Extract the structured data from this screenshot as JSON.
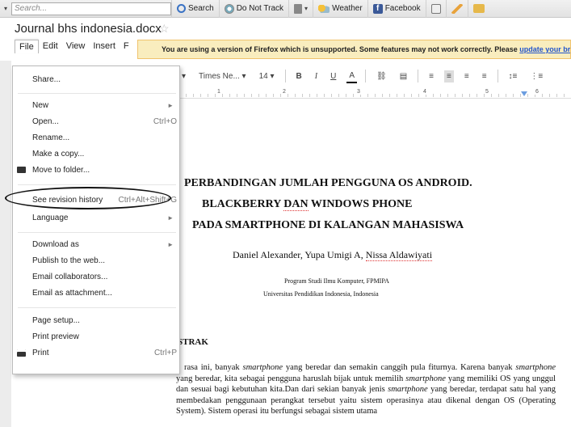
{
  "browser_toolbar": {
    "search_placeholder": "Search...",
    "buttons": [
      {
        "label": "Search",
        "icon": "search-icon"
      },
      {
        "label": "Do Not Track",
        "icon": "do-not-track-icon"
      },
      {
        "label": "",
        "icon": "trash-icon"
      },
      {
        "label": "Weather",
        "icon": "weather-icon"
      },
      {
        "label": "Facebook",
        "icon": "facebook-icon"
      }
    ],
    "facebook_letter": "f"
  },
  "doc_title": "Journal bhs indonesia.docx",
  "star": "☆",
  "menubar": [
    "File",
    "Edit",
    "View",
    "Insert",
    "F"
  ],
  "warning": {
    "text": "You are using a version of Firefox which is unsupported. Some features may not work correctly. Please ",
    "link": "update your browser"
  },
  "format_toolbar": {
    "font": "Times Ne...",
    "size": "14",
    "bold": "B",
    "italic": "I",
    "underline": "U",
    "text_color": "A"
  },
  "ruler": [
    "1",
    "2",
    "3",
    "4",
    "5",
    "6"
  ],
  "file_menu": {
    "share": "Share...",
    "new": "New",
    "open": "Open...",
    "open_shortcut": "Ctrl+O",
    "rename": "Rename...",
    "copy": "Make a copy...",
    "move": "Move to folder...",
    "revision": "See revision history",
    "revision_shortcut": "Ctrl+Alt+Shift+G",
    "language": "Language",
    "download": "Download as",
    "publish": "Publish to the web...",
    "email_collab": "Email collaborators...",
    "email_attach": "Email as attachment...",
    "page_setup": "Page setup...",
    "print_preview": "Print preview",
    "print": "Print",
    "print_shortcut": "Ctrl+P"
  },
  "document": {
    "title1": "PERBANDINGAN JUMLAH PENGGUNA OS ANDROID.",
    "title2a": "BLACKBERRY ",
    "title2b": "DAN",
    "title2c": " WINDOWS PHONE",
    "title3": "PADA SMARTPHONE DI KALANGAN MAHASISWA",
    "authors_a": "Daniel Alexander, Yupa Umigi A, ",
    "authors_b": "Nissa Aldawiyati",
    "affil1": "Program Studi Ilmu Komputer, FPMIPA",
    "affil2": "Universitas Pendidikan Indonesia, Indonesia",
    "abstract_heading": "STRAK",
    "para": [
      "rasa ini, banyak ",
      "smartphone",
      "  yang beredar dan semakin canggih pula fiturnya. Karena banyak ",
      "smartphone",
      " yang beredar, kita sebagai pengguna haruslah bijak untuk memilih ",
      "smartphone",
      " yang memiliki OS yang unggul dan sesuai bagi kebutuhan kita.Dan dari sekian banyak jenis ",
      "smartphone",
      " yang beredar, terdapat satu hal yang membedakan penggunaan perangkat tersebut yaitu sistem operasinya atau dikenal dengan OS (Operating System). Sistem operasi itu berfungsi sebagai sistem utama"
    ]
  }
}
